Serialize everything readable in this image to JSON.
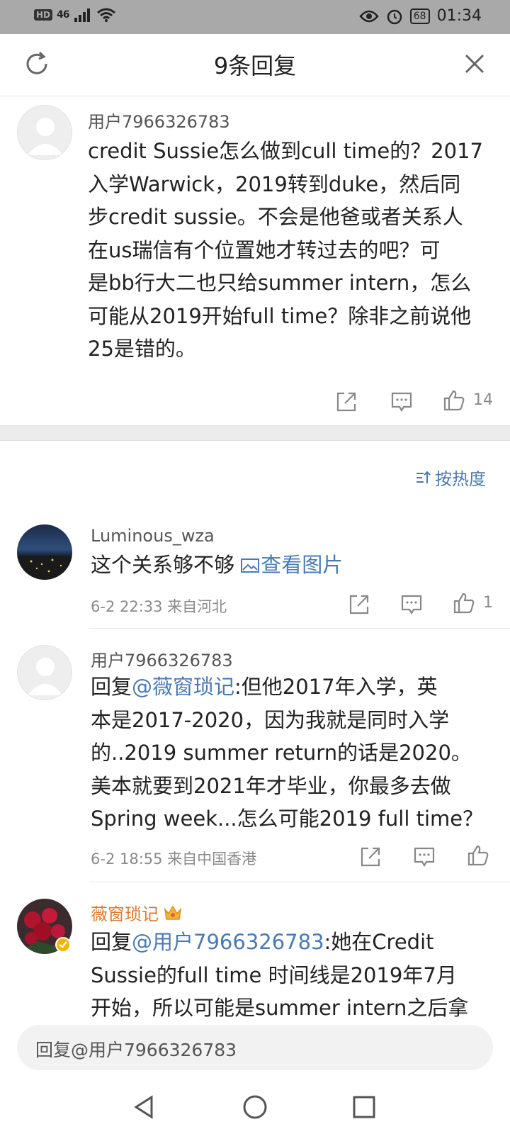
{
  "status_bar": {
    "hd": "HD",
    "network": "46",
    "battery": "68",
    "time": "01:34"
  },
  "header": {
    "title": "9条回复"
  },
  "main_comment": {
    "username": "用户7966326783",
    "lines": [
      "credit Sussie怎么做到cull time的？2017",
      "入学Warwick，2019转到duke，然后同",
      "步credit sussie。不会是他爸或者关系人",
      "在us瑞信有个位置她才转过去的吧？可",
      "是bb行大二也只给summer intern，怎么",
      "可能从2019开始full time？除非之前说他",
      "25是错的。"
    ],
    "like_count": "14"
  },
  "sort": {
    "label": "按热度"
  },
  "replies": [
    {
      "username": "Luminous_wza",
      "text": "这个关系够不够 ",
      "link": "查看图片",
      "timestamp": "6-2 22:33 来自河北",
      "like_count": "1"
    },
    {
      "username": "用户7966326783",
      "prefix": "回复",
      "mention": "@薇窗琐记",
      "lines": [
        ":但他2017年入学，英",
        "本是2017-2020，因为我就是同时入学",
        "的..2019 summer return的话是2020。",
        "美本就要到2021年才毕业，你最多去做",
        "Spring week...怎么可能2019 full time？"
      ],
      "timestamp": "6-2 18:55 来自中国香港",
      "like_count": ""
    },
    {
      "username": "薇窗琐记",
      "prefix": "回复",
      "mention": "@用户7966326783",
      "lines": [
        ":她在Credit",
        "Sussie的full time 时间线是2019年7月",
        "开始，所以可能是summer intern之后拿"
      ]
    }
  ],
  "reply_input": {
    "placeholder": "回复@用户7966326783"
  },
  "colors": {
    "link": "#4a7ab5",
    "vip_name": "#e07a2e",
    "verified": "#f5b400"
  }
}
